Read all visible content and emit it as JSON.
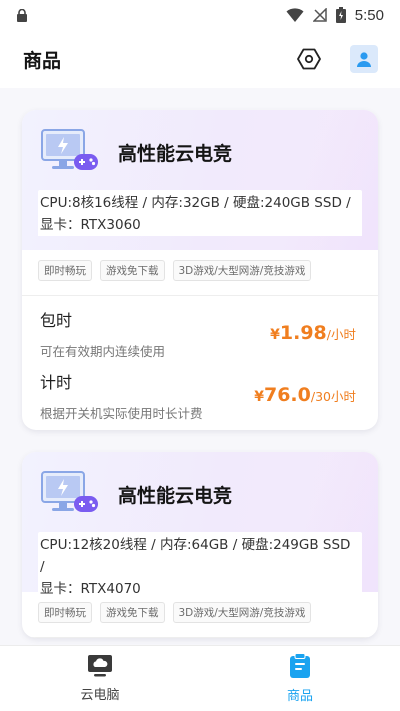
{
  "status_bar": {
    "time": "5:50",
    "icons": [
      "lock-icon",
      "wifi-icon",
      "no-signal-icon",
      "battery-icon"
    ]
  },
  "app_bar": {
    "title": "商品",
    "actions": [
      "settings-hexagon-icon",
      "user-icon"
    ]
  },
  "colors": {
    "price": "#f07e1f",
    "active_tab": "#1aa3f0",
    "user_button_bg": "#dbe9fb"
  },
  "products": [
    {
      "title": "高性能云电竞",
      "specs_line1": "CPU:8核16线程 / 内存:32GB / 硬盘:240GB SSD /",
      "specs_line2": "显卡：RTX3060",
      "tags": [
        "即时畅玩",
        "游戏免下载",
        "3D游戏/大型网游/竞技游戏"
      ],
      "plans": [
        {
          "name": "包时",
          "desc": "可在有效期内连续使用",
          "currency": "¥",
          "amount": "1.98",
          "unit": "/小时"
        },
        {
          "name": "计时",
          "desc": "根据开关机实际使用时长计费",
          "currency": "¥",
          "amount": "76.0",
          "unit": "/30小时"
        }
      ]
    },
    {
      "title": "高性能云电竞",
      "specs_line1": "CPU:12核20线程 / 内存:64GB / 硬盘:249GB SSD /",
      "specs_line2": "显卡：RTX4070",
      "tags": [
        "即时畅玩",
        "游戏免下载",
        "3D游戏/大型网游/竞技游戏"
      ]
    }
  ],
  "bottom_nav": [
    {
      "label": "云电脑",
      "icon": "cloud-pc-icon",
      "active": false
    },
    {
      "label": "商品",
      "icon": "clipboard-icon",
      "active": true
    }
  ]
}
